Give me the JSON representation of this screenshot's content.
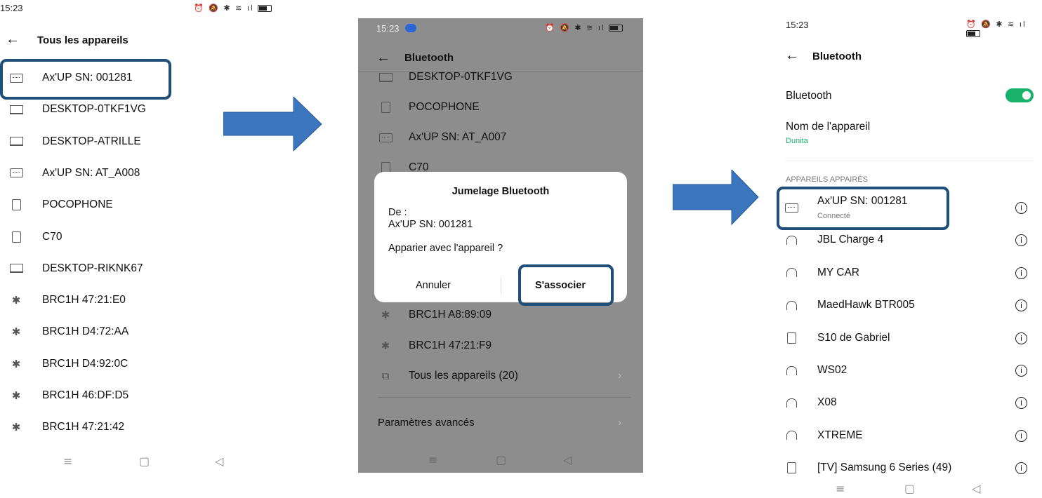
{
  "screen1": {
    "status_time": "15:23",
    "title": "Tous les appareils",
    "devices": [
      {
        "label": "Ax'UP SN: 001281",
        "icon": "keyboard-icon"
      },
      {
        "label": "DESKTOP-0TKF1VG",
        "icon": "laptop-icon"
      },
      {
        "label": "DESKTOP-ATRILLE",
        "icon": "laptop-icon"
      },
      {
        "label": "Ax'UP SN: AT_A008",
        "icon": "keyboard-icon"
      },
      {
        "label": "POCOPHONE",
        "icon": "phone-icon"
      },
      {
        "label": "C70",
        "icon": "phone-icon"
      },
      {
        "label": "DESKTOP-RIKNK67",
        "icon": "laptop-icon"
      },
      {
        "label": "BRC1H 47:21:E0",
        "icon": "bluetooth-icon"
      },
      {
        "label": "BRC1H D4:72:AA",
        "icon": "bluetooth-icon"
      },
      {
        "label": "BRC1H D4:92:0C",
        "icon": "bluetooth-icon"
      },
      {
        "label": "BRC1H 46:DF:D5",
        "icon": "bluetooth-icon"
      },
      {
        "label": "BRC1H 47:21:42",
        "icon": "bluetooth-icon"
      }
    ]
  },
  "screen2": {
    "status_time": "15:23",
    "title": "Bluetooth",
    "devices_top": [
      {
        "label": "DESKTOP-0TKF1VG",
        "icon": "laptop-icon"
      },
      {
        "label": "POCOPHONE",
        "icon": "phone-icon"
      },
      {
        "label": "Ax'UP SN: AT_A007",
        "icon": "keyboard-icon"
      },
      {
        "label": "C70",
        "icon": "phone-icon"
      }
    ],
    "devices_bottom": [
      {
        "label": "BRC1H A8:89:09",
        "icon": "bluetooth-icon"
      },
      {
        "label": "BRC1H 47:21:F9",
        "icon": "bluetooth-icon"
      }
    ],
    "all_devices": "Tous les appareils (20)",
    "advanced": "Paramètres avancés",
    "dialog": {
      "title": "Jumelage Bluetooth",
      "from_label": "De :",
      "device": "Ax'UP SN: 001281",
      "question": "Apparier avec l'appareil ?",
      "cancel": "Annuler",
      "confirm": "S'associer"
    }
  },
  "screen3": {
    "status_time": "15:23",
    "title": "Bluetooth",
    "bluetooth_label": "Bluetooth",
    "device_name_label": "Nom de l'appareil",
    "device_name_value": "Dunita",
    "section": "APPAREILS APPAIRÉS",
    "paired": [
      {
        "label": "Ax'UP SN: 001281",
        "sub": "Connecté",
        "icon": "keyboard-icon"
      },
      {
        "label": "JBL Charge 4",
        "icon": "headphones-icon"
      },
      {
        "label": "MY CAR",
        "icon": "headphones-icon"
      },
      {
        "label": "MaedHawk BTR005",
        "icon": "headphones-icon"
      },
      {
        "label": "S10 de Gabriel",
        "icon": "phone-icon"
      },
      {
        "label": "WS02",
        "icon": "headphones-icon"
      },
      {
        "label": "X08",
        "icon": "headphones-icon"
      },
      {
        "label": "XTREME",
        "icon": "headphones-icon"
      },
      {
        "label": "[TV] Samsung 6 Series (49)",
        "icon": "tv-icon"
      }
    ]
  },
  "colors": {
    "highlight": "#1f4e79",
    "arrow": "#3a75bd",
    "toggle_on": "#19b26b",
    "dim_overlay": "#8d8d8d"
  }
}
